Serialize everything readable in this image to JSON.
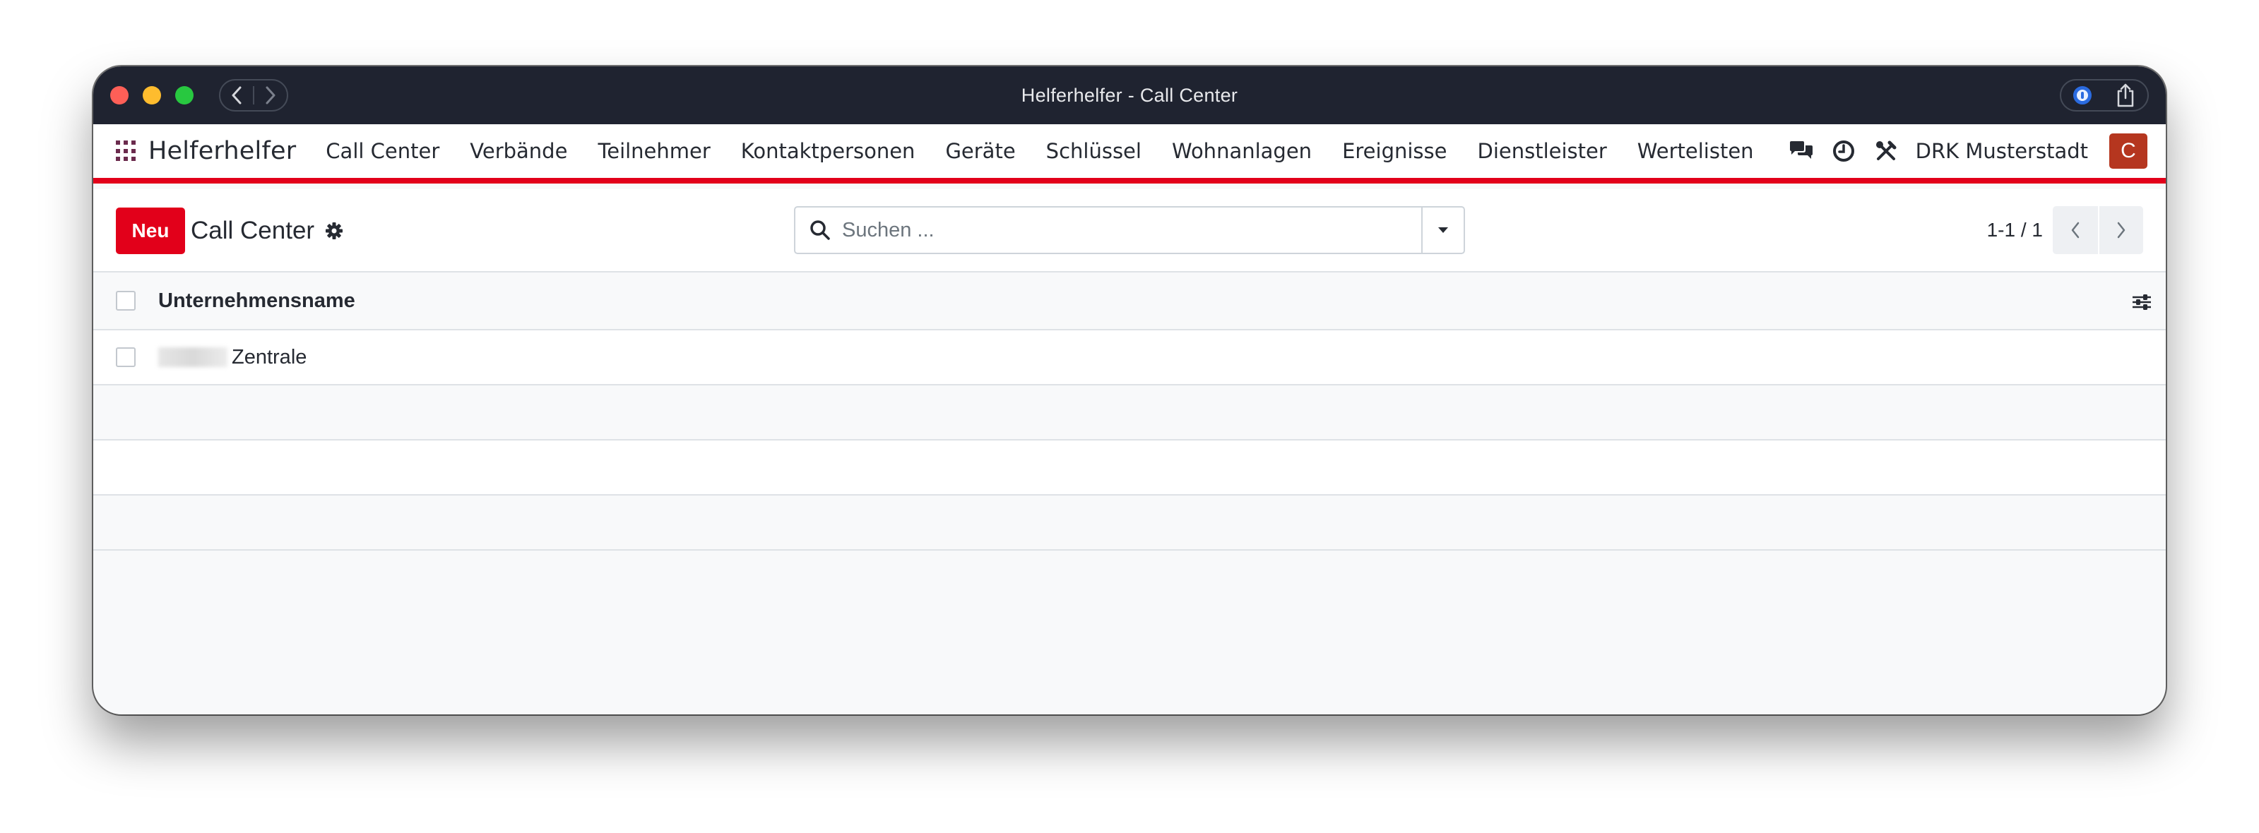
{
  "window": {
    "title": "Helferhelfer - Call Center"
  },
  "navbar": {
    "brand": "Helferhelfer",
    "menu": [
      {
        "label": "Call Center"
      },
      {
        "label": "Verbände"
      },
      {
        "label": "Teilnehmer"
      },
      {
        "label": "Kontaktpersonen"
      },
      {
        "label": "Geräte"
      },
      {
        "label": "Schlüssel"
      },
      {
        "label": "Wohnanlagen"
      },
      {
        "label": "Ereignisse"
      },
      {
        "label": "Dienstleister"
      },
      {
        "label": "Wertelisten"
      }
    ],
    "company": "DRK Musterstadt",
    "avatar_letter": "C",
    "icons": [
      "apps-icon",
      "chat-icon",
      "clock-icon",
      "tools-icon"
    ]
  },
  "control": {
    "new_label": "Neu",
    "breadcrumb_title": "Call Center",
    "search_placeholder": "Suchen ...",
    "pager_value": "1-1 / 1"
  },
  "list": {
    "columns": [
      "Unternehmensname"
    ],
    "rows": [
      {
        "name": "Zentrale",
        "name_prefix_redacted": true
      }
    ]
  },
  "colors": {
    "accent": "#e2001a",
    "titlebar": "#1f2330",
    "avatar": "#b5361f"
  }
}
